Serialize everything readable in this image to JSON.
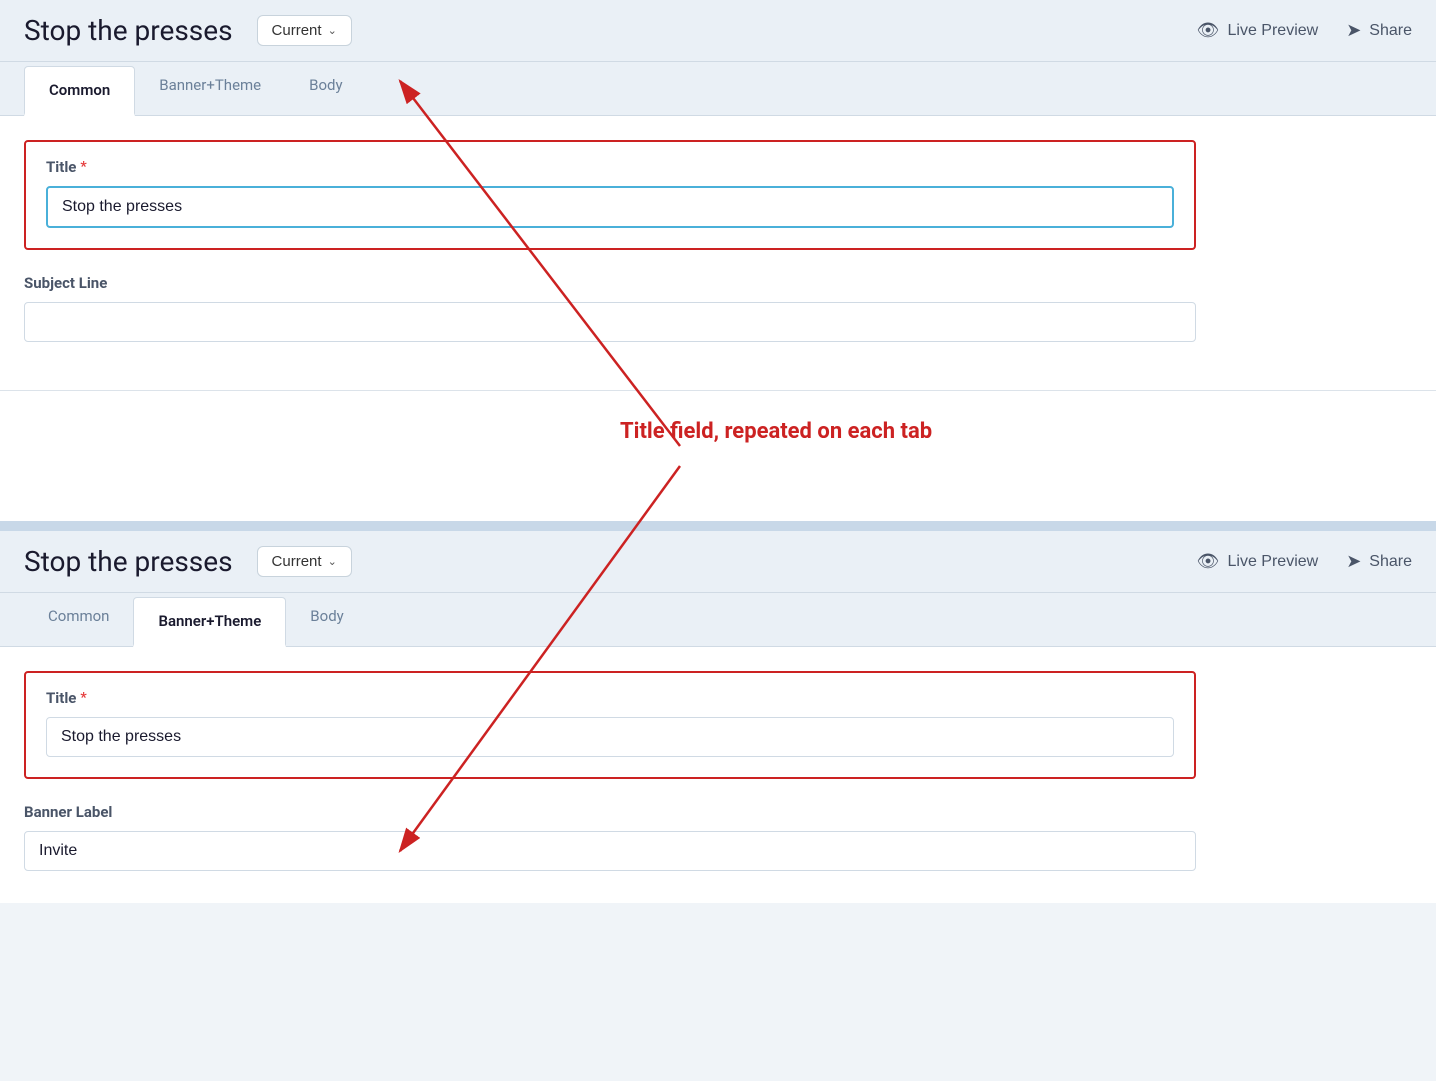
{
  "top_panel": {
    "title": "Stop the presses",
    "version_dropdown": {
      "label": "Current",
      "icon": "chevron-down"
    },
    "actions": {
      "live_preview": "Live Preview",
      "share": "Share"
    },
    "tabs": [
      {
        "id": "common",
        "label": "Common",
        "active": true
      },
      {
        "id": "banner_theme",
        "label": "Banner+Theme",
        "active": false
      },
      {
        "id": "body",
        "label": "Body",
        "active": false
      }
    ],
    "fields": {
      "title_label": "Title",
      "title_required": "*",
      "title_value": "Stop the presses",
      "subject_line_label": "Subject Line",
      "subject_line_value": ""
    }
  },
  "annotation": {
    "text": "Title field, repeated on each tab"
  },
  "bottom_panel": {
    "title": "Stop the presses",
    "version_dropdown": {
      "label": "Current",
      "icon": "chevron-down"
    },
    "actions": {
      "live_preview": "Live Preview",
      "share": "Share"
    },
    "tabs": [
      {
        "id": "common",
        "label": "Common",
        "active": false
      },
      {
        "id": "banner_theme",
        "label": "Banner+Theme",
        "active": true
      },
      {
        "id": "body",
        "label": "Body",
        "active": false
      }
    ],
    "fields": {
      "title_label": "Title",
      "title_required": "*",
      "title_value": "Stop the presses",
      "banner_label_label": "Banner Label",
      "banner_label_value": "Invite"
    }
  }
}
